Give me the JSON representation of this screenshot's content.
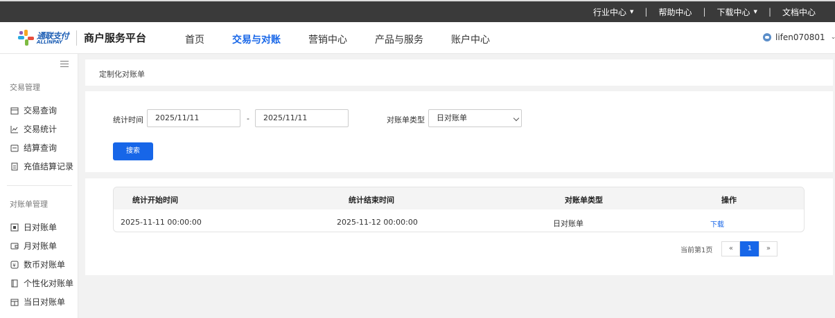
{
  "topbar": {
    "industry": "行业中心",
    "help": "帮助中心",
    "download": "下载中心",
    "docs": "文档中心",
    "separator": "|"
  },
  "header": {
    "logo_cn": "通联支付",
    "logo_en": "ALLINPAY",
    "platform": "商户服务平台",
    "nav": [
      "首页",
      "交易与对账",
      "营销中心",
      "产品与服务",
      "账户中心"
    ],
    "nav_active": "交易与对账",
    "username": "lifen070801"
  },
  "sidebar": {
    "section1": "交易管理",
    "items1": [
      "交易查询",
      "交易统计",
      "结算查询",
      "充值结算记录"
    ],
    "section2": "对账单管理",
    "items2": [
      "日对账单",
      "月对账单",
      "数币对账单",
      "个性化对账单",
      "当日对账单"
    ]
  },
  "breadcrumb": "定制化对账单",
  "filter": {
    "time_label": "统计时间",
    "start_date": "2025/11/11",
    "dash": "-",
    "end_date": "2025/11/11",
    "type_label": "对账单类型",
    "type_value": "日对账单",
    "search_button": "搜索"
  },
  "table": {
    "headers": [
      "统计开始时间",
      "统计结束时间",
      "对账单类型",
      "操作"
    ],
    "rows": [
      {
        "start": "2025-11-11 00:00:00",
        "end": "2025-11-12 00:00:00",
        "type": "日对账单",
        "action": "下载"
      }
    ]
  },
  "pager": {
    "info": "当前第1页",
    "prev": "«",
    "current": "1",
    "next": "»"
  },
  "colors": {
    "accent": "#1766e8",
    "topbar_bg": "#3a3a3a",
    "page_bg": "#f2f2f2"
  }
}
